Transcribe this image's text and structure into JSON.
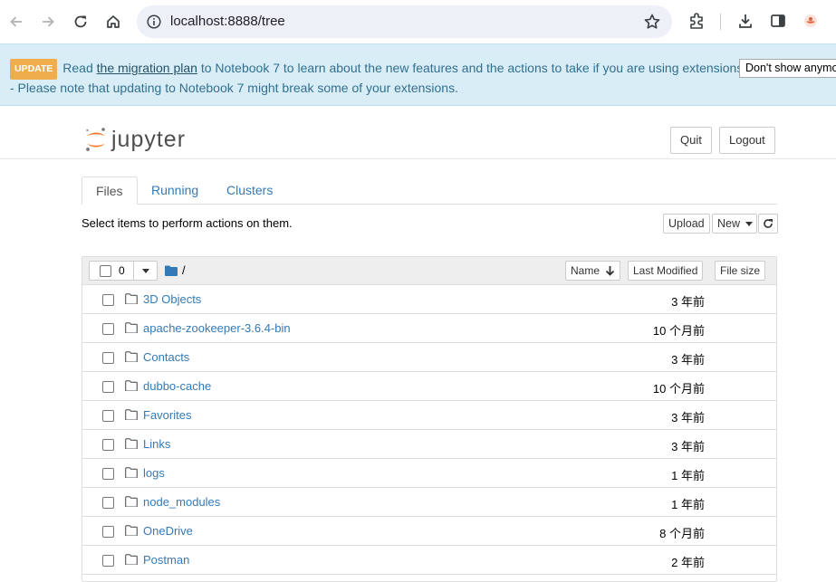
{
  "browser": {
    "url": "localhost:8888/tree"
  },
  "banner": {
    "badge": "UPDATE",
    "text_before": "Read ",
    "link": "the migration plan",
    "text_after": " to Notebook 7 to learn about the new features and the actions to take if you are using extensions - Please note that updating to Notebook 7 might break some of your extensions.",
    "dismiss_label": "Don't show anymo"
  },
  "header": {
    "logo_text": "jupyter",
    "quit_label": "Quit",
    "logout_label": "Logout"
  },
  "tabs": [
    {
      "label": "Files"
    },
    {
      "label": "Running"
    },
    {
      "label": "Clusters"
    }
  ],
  "toolbar": {
    "hint": "Select items to perform actions on them.",
    "upload_label": "Upload",
    "new_label": "New"
  },
  "list_header": {
    "selected_count": "0",
    "path": "/",
    "sort_name_label": "Name",
    "last_modified_label": "Last Modified",
    "file_size_label": "File size"
  },
  "files": [
    {
      "name": "3D Objects",
      "modified": "3 年前"
    },
    {
      "name": "apache-zookeeper-3.6.4-bin",
      "modified": "10 个月前"
    },
    {
      "name": "Contacts",
      "modified": "3 年前"
    },
    {
      "name": "dubbo-cache",
      "modified": "10 个月前"
    },
    {
      "name": "Favorites",
      "modified": "3 年前"
    },
    {
      "name": "Links",
      "modified": "3 年前"
    },
    {
      "name": "logs",
      "modified": "1 年前"
    },
    {
      "name": "node_modules",
      "modified": "1 年前"
    },
    {
      "name": "OneDrive",
      "modified": "8 个月前"
    },
    {
      "name": "Postman",
      "modified": "2 年前"
    }
  ]
}
